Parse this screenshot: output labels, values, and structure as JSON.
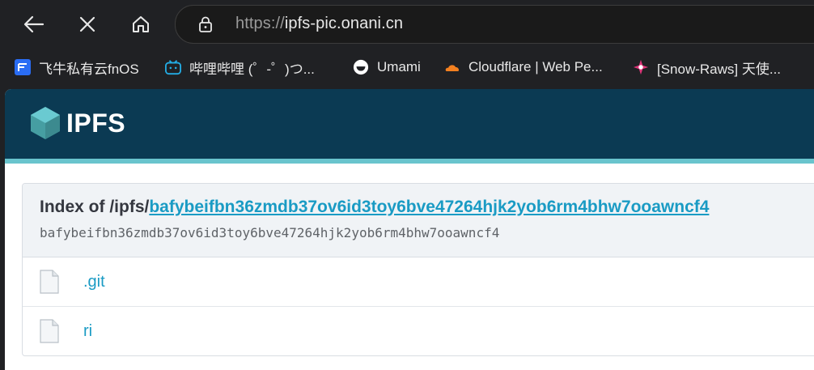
{
  "browser": {
    "url_protocol": "https://",
    "url_host": "ipfs-pic.onani.cn"
  },
  "bookmarks": [
    {
      "label": "飞牛私有云fnOS",
      "icon": "fnos-icon",
      "color": "#2a6df4"
    },
    {
      "label": "哔哩哔哩 (゜-゜)つ...",
      "icon": "bilibili-icon",
      "color": "#23ade5"
    },
    {
      "label": "Umami",
      "icon": "umami-icon",
      "color": "#ffffff"
    },
    {
      "label": "Cloudflare | Web Pe...",
      "icon": "cloudflare-icon",
      "color": "#f38020"
    },
    {
      "label": "[Snow-Raws] 天使...",
      "icon": "snow-raws-icon",
      "color": "#e0357a"
    }
  ],
  "header": {
    "logo_text": "IPFS",
    "bg_color": "#0b3a53",
    "accent_color": "#69c4cd"
  },
  "index": {
    "prefix": "Index of /ipfs/",
    "cid": "bafybeifbn36zmdb37ov6id3toy6bve47264hjk2yob6rm4bhw7ooawncf4",
    "cid_subtitle": "bafybeifbn36zmdb37ov6id3toy6bve47264hjk2yob6rm4bhw7ooawncf4"
  },
  "files": [
    {
      "name": ".git"
    },
    {
      "name": "ri"
    }
  ]
}
